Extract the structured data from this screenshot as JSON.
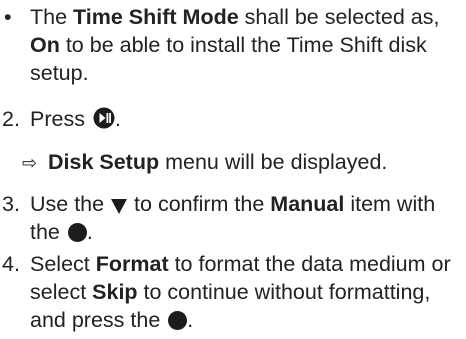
{
  "bullet": {
    "marker": "•",
    "pre": "The ",
    "b1": "Time Shift Mode",
    "mid": " shall be selected as, ",
    "b2": "On",
    "post": " to be able to install the Time Shift disk setup."
  },
  "step2": {
    "num": "2.",
    "pre": "Press ",
    "icon": "play-pause-button-icon",
    "post": "."
  },
  "result": {
    "arrow": "⇨",
    "bold": "Disk Setup",
    "post": " menu will be displayed."
  },
  "step3": {
    "num": "3.",
    "pre": "Use the ",
    "icon": "down-arrow-icon",
    "mid": " to confirm the ",
    "bold": "Manual",
    "mid2": " item with the ",
    "icon2": "ok-button-icon",
    "post": "."
  },
  "step4": {
    "num": "4.",
    "pre": "Select ",
    "b1": "Format",
    "mid": " to format the data me­dium or select ",
    "b2": "Skip",
    "post": "  to continue without formatting, and press the ",
    "icon": "ok-button-icon",
    "end": "."
  }
}
